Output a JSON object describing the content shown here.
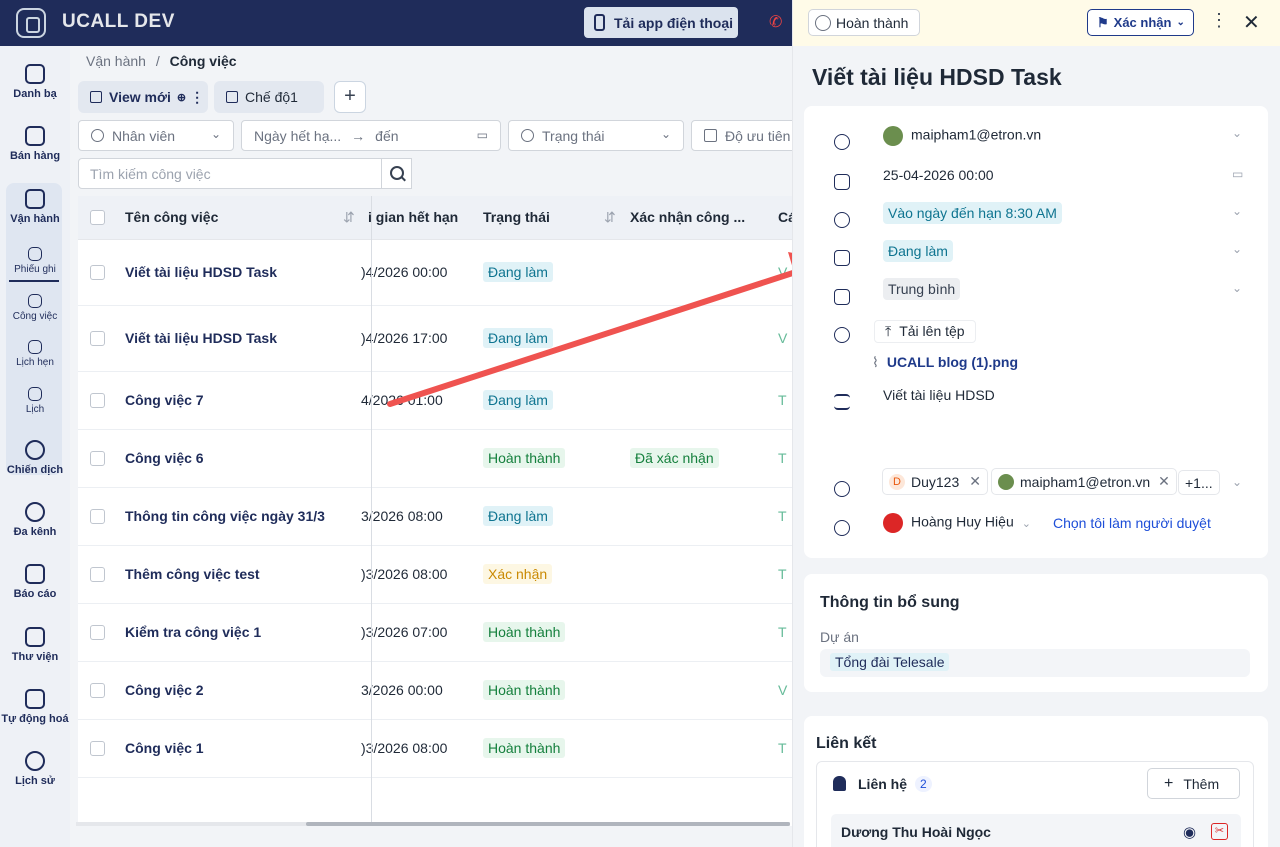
{
  "header": {
    "brand": "UCALL DEV",
    "app_button": "Tải app điện thoại"
  },
  "sidebar": {
    "items": [
      {
        "label": "Danh bạ",
        "icon": "contacts-icon"
      },
      {
        "label": "Bán hàng",
        "icon": "sales-icon"
      },
      {
        "label": "Vận hành",
        "icon": "operations-icon"
      },
      {
        "label": "Phiếu ghi",
        "icon": "ticket-icon"
      },
      {
        "label": "Công việc",
        "icon": "task-icon"
      },
      {
        "label": "Lịch hẹn",
        "icon": "appointment-icon"
      },
      {
        "label": "Lịch",
        "icon": "calendar-icon"
      },
      {
        "label": "Chiến dịch",
        "icon": "campaign-icon"
      },
      {
        "label": "Đa kênh",
        "icon": "omnichannel-icon"
      },
      {
        "label": "Báo cáo",
        "icon": "report-icon"
      },
      {
        "label": "Thư viện",
        "icon": "library-icon"
      },
      {
        "label": "Tự động hoá",
        "icon": "automation-icon"
      },
      {
        "label": "Lịch sử",
        "icon": "history-icon"
      }
    ]
  },
  "breadcrumb": {
    "parent": "Vận hành",
    "separator": "/",
    "current": "Công việc"
  },
  "tabs": [
    {
      "label": "View mới"
    },
    {
      "label": "Chế độ1"
    }
  ],
  "filters": {
    "employee": "Nhân viên",
    "due_from": "Ngày hết hạ...",
    "arrow": "→",
    "due_to": "đến",
    "status": "Trạng thái",
    "priority": "Độ ưu tiên"
  },
  "search": {
    "placeholder": "Tìm kiếm công việc"
  },
  "table": {
    "headers": {
      "name": "Tên công việc",
      "due": "i gian hết hạn",
      "status": "Trạng thái",
      "confirm": "Xác nhận công ...",
      "extra": "Cá"
    },
    "rows": [
      {
        "name": "Viết tài liệu HDSD Task",
        "due": ")4/2026 00:00",
        "status": "Đang làm",
        "confirm": "",
        "extra": "V"
      },
      {
        "name": "Viết tài liệu HDSD Task",
        "due": ")4/2026 17:00",
        "status": "Đang làm",
        "confirm": "",
        "extra": "V"
      },
      {
        "name": "Công việc 7",
        "due": "4/2026 01:00",
        "status": "Đang làm",
        "confirm": "",
        "extra": "T"
      },
      {
        "name": "Công việc 6",
        "due": "",
        "status": "Hoàn thành",
        "confirm": "Đã xác nhận",
        "extra": "T"
      },
      {
        "name": "Thông tin công việc ngày 31/3",
        "due": "3/2026 08:00",
        "status": "Đang làm",
        "confirm": "",
        "extra": "T"
      },
      {
        "name": "Thêm công việc test",
        "due": ")3/2026 08:00",
        "status": "Xác nhận",
        "confirm": "",
        "extra": "T"
      },
      {
        "name": "Kiểm tra công việc 1",
        "due": ")3/2026 07:00",
        "status": "Hoàn thành",
        "confirm": "",
        "extra": "T"
      },
      {
        "name": "Công việc 2",
        "due": "3/2026 00:00",
        "status": "Hoàn thành",
        "confirm": "",
        "extra": "V"
      },
      {
        "name": "Công việc 1",
        "due": ")3/2026 08:00",
        "status": "Hoàn thành",
        "confirm": "",
        "extra": "T"
      }
    ]
  },
  "drawer": {
    "complete_label": "Hoàn thành",
    "confirm_label": "Xác nhận",
    "title": "Viết tài liệu HDSD Task",
    "assignee": "maipham1@etron.vn",
    "due_date": "25-04-2026 00:00",
    "reminder": "Vào ngày đến hạn 8:30 AM",
    "status": "Đang làm",
    "priority": "Trung bình",
    "upload_label": "Tải lên tệp",
    "attachment": "UCALL blog (1).png",
    "description": "Viết tài liệu HDSD",
    "followers": [
      {
        "initial": "D",
        "name": "Duy123"
      },
      {
        "name": "maipham1@etron.vn"
      }
    ],
    "followers_more": "+1...",
    "approver": "Hoàng Huy Hiệu",
    "approver_self": "Chọn tôi làm người duyệt",
    "extra_section": "Thông tin bổ sung",
    "project_label": "Dự án",
    "project_value": "Tổng đài Telesale",
    "links_section": "Liên kết",
    "contacts_label": "Liên hệ",
    "contacts_count": "2",
    "add_label": "Thêm",
    "contact_name": "Dương Thu Hoài Ngọc"
  },
  "colors": {
    "navy": "#1f2c5a",
    "status_doing": "#0e7490",
    "status_done": "#15803d",
    "status_confirm": "#ca8a04",
    "link": "#1d4ed8"
  }
}
